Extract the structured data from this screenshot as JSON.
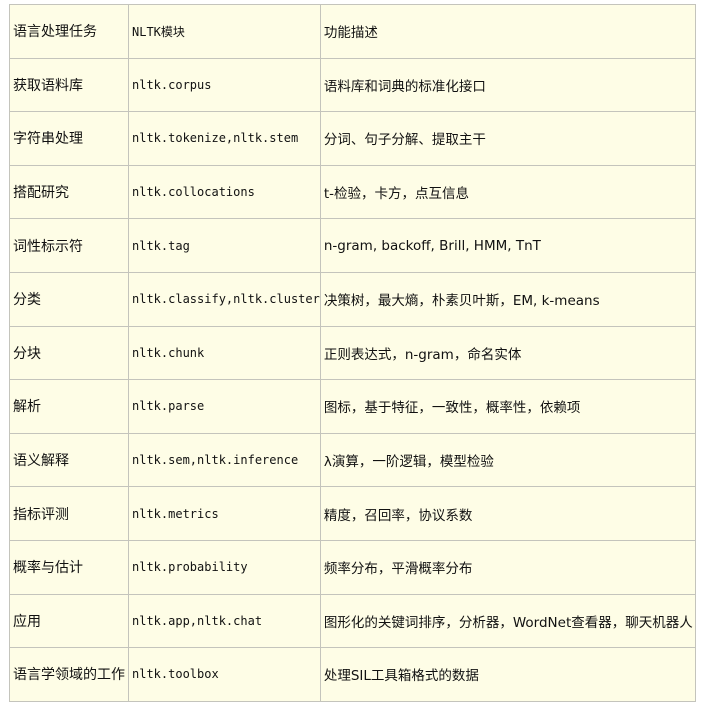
{
  "headers": [
    "语言处理任务",
    "NLTK模块",
    "功能描述"
  ],
  "rows": [
    [
      "获取语料库",
      "nltk.corpus",
      "语料库和词典的标准化接口"
    ],
    [
      "字符串处理",
      "nltk.tokenize,nltk.stem",
      "分词、句子分解、提取主干"
    ],
    [
      "搭配研究",
      "nltk.collocations",
      "t-检验，卡方，点互信息"
    ],
    [
      "词性标示符",
      "nltk.tag",
      "n-gram, backoff, Brill, HMM, TnT"
    ],
    [
      "分类",
      "nltk.classify,nltk.cluster",
      "决策树，最大熵，朴素贝叶斯，EM, k-means"
    ],
    [
      "分块",
      "nltk.chunk",
      "正则表达式，n-gram，命名实体"
    ],
    [
      "解析",
      "nltk.parse",
      "图标，基于特征，一致性，概率性，依赖项"
    ],
    [
      "语义解释",
      "nltk.sem,nltk.inference",
      "λ演算，一阶逻辑，模型检验"
    ],
    [
      "指标评测",
      "nltk.metrics",
      "精度，召回率，协议系数"
    ],
    [
      "概率与估计",
      "nltk.probability",
      "频率分布，平滑概率分布"
    ],
    [
      "应用",
      "nltk.app,nltk.chat",
      "图形化的关键词排序，分析器，WordNet查看器，聊天机器人"
    ],
    [
      "语言学领域的工作",
      "nltk.toolbox",
      "处理SIL工具箱格式的数据"
    ]
  ]
}
